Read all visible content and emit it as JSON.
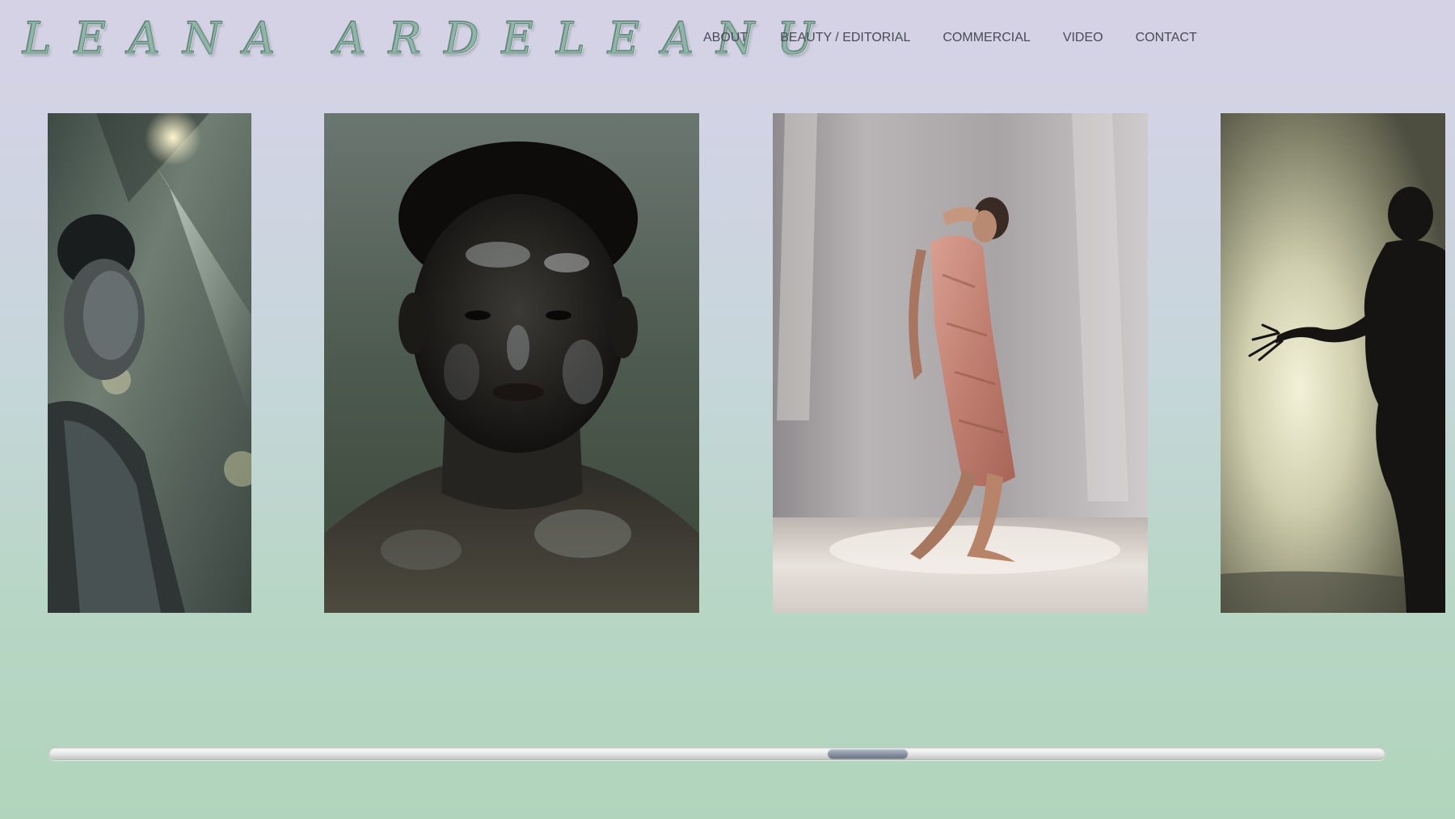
{
  "site": {
    "logo_text": "LEANA ARDELEANU"
  },
  "nav": {
    "items": [
      {
        "label": "ABOUT"
      },
      {
        "label": "BEAUTY / EDITORIAL"
      },
      {
        "label": "COMMERCIAL"
      },
      {
        "label": "VIDEO"
      },
      {
        "label": "CONTACT"
      }
    ]
  },
  "gallery": {
    "images": [
      {
        "subject": "model-behind-prism-glass",
        "tone": "green-grey"
      },
      {
        "subject": "close-up-glossy-portrait",
        "tone": "olive-green"
      },
      {
        "subject": "figure-walking-in-pink-dress",
        "tone": "warm-grey"
      },
      {
        "subject": "silhouette-reaching-hand",
        "tone": "yellow-spotlight"
      }
    ]
  },
  "scroll": {
    "position_fraction": 0.62,
    "visible_fraction": 0.06
  },
  "colors": {
    "background_top": "#d6d2e6",
    "background_bottom": "#b1d5bc",
    "nav_text": "#4a4a55",
    "logo_chrome": "#8fb4a8"
  }
}
